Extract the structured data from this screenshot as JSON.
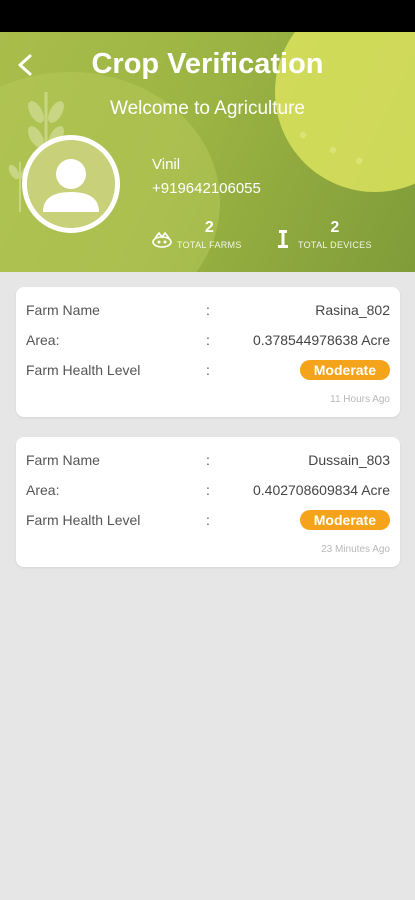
{
  "header": {
    "title": "Crop Verification",
    "subtitle": "Welcome to Agriculture",
    "back_icon": "chevron-left-icon"
  },
  "user": {
    "name": "Vinil",
    "phone": "+919642106055",
    "avatar_icon": "user-avatar-icon"
  },
  "stats": {
    "farms": {
      "count": "2",
      "label": "TOTAL FARMS",
      "icon": "farm-icon"
    },
    "devices": {
      "count": "2",
      "label": "TOTAL DEVICES",
      "icon": "device-icon"
    }
  },
  "labels": {
    "farm_name": "Farm Name",
    "area": "Area:",
    "health": "Farm Health Level",
    "colon": ":"
  },
  "farms": [
    {
      "name": "Rasina_802",
      "area": "0.378544978638 Acre",
      "health": "Moderate",
      "time": "11 Hours Ago"
    },
    {
      "name": "Dussain_803",
      "area": "0.402708609834 Acre",
      "health": "Moderate",
      "time": "23 Minutes Ago"
    }
  ],
  "colors": {
    "header_green": "#9cb443",
    "badge_orange": "#f5a31a",
    "background": "#e6e6e6"
  }
}
